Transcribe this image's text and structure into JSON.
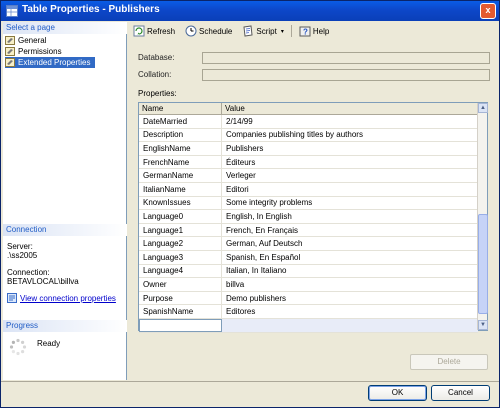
{
  "window": {
    "title": "Table Properties - Publishers",
    "close": "x"
  },
  "left": {
    "select_header": "Select a page",
    "pages": [
      {
        "label": "General"
      },
      {
        "label": "Permissions"
      },
      {
        "label": "Extended Properties"
      }
    ],
    "connection_header": "Connection",
    "server_label": "Server:",
    "server_value": ".\\ss2005",
    "connection_label": "Connection:",
    "connection_value": "BETAVLOCAL\\billva",
    "view_link": "View connection properties",
    "progress_header": "Progress",
    "progress_status": "Ready"
  },
  "toolbar": {
    "refresh": "Refresh",
    "schedule": "Schedule",
    "script": "Script",
    "script_arrow": "▾",
    "help": "Help"
  },
  "fields": {
    "database_label": "Database:",
    "database_value": "",
    "collation_label": "Collation:",
    "collation_value": ""
  },
  "properties": {
    "label": "Properties:",
    "col_name": "Name",
    "col_value": "Value",
    "rows": [
      {
        "name": "DateMarried",
        "value": "2/14/99"
      },
      {
        "name": "Description",
        "value": "Companies publishing titles by authors"
      },
      {
        "name": "EnglishName",
        "value": "Publishers"
      },
      {
        "name": "FrenchName",
        "value": "Éditeurs"
      },
      {
        "name": "GermanName",
        "value": "Verleger"
      },
      {
        "name": "ItalianName",
        "value": "Editori"
      },
      {
        "name": "KnownIssues",
        "value": "Some integrity problems"
      },
      {
        "name": "Language0",
        "value": "English, In English"
      },
      {
        "name": "Language1",
        "value": "French, En Français"
      },
      {
        "name": "Language2",
        "value": "German, Auf Deutsch"
      },
      {
        "name": "Language3",
        "value": "Spanish, En Español"
      },
      {
        "name": "Language4",
        "value": "Italian, In Italiano"
      },
      {
        "name": "Owner",
        "value": "billva"
      },
      {
        "name": "Purpose",
        "value": "Demo publishers"
      },
      {
        "name": "SpanishName",
        "value": "Editores"
      }
    ],
    "scroll_up": "▲",
    "scroll_down": "▼"
  },
  "buttons": {
    "delete": "Delete",
    "ok": "OK",
    "cancel": "Cancel"
  },
  "colors": {
    "title_bar": "#0a5ce6",
    "selection": "#316ac5",
    "section_header_text": "#215dc6"
  }
}
